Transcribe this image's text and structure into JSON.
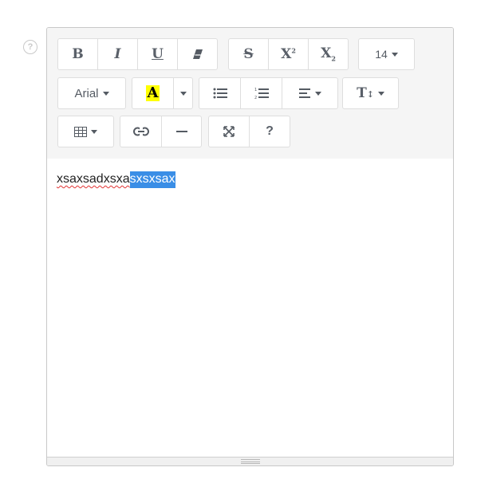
{
  "help": {
    "glyph": "?"
  },
  "toolbar": {
    "bold_glyph": "B",
    "italic_glyph": "I",
    "underline_glyph": "U",
    "strike_glyph": "S",
    "superscript_glyph": "X",
    "superscript_mark": "2",
    "subscript_glyph": "X",
    "subscript_mark": "2",
    "font_size": "14",
    "font_name": "Arial",
    "color_glyph": "A",
    "color_highlight": "#ffff00",
    "help_glyph": "?",
    "line_height_glyph": "T",
    "icons": [
      "eraser-icon",
      "unordered-list-icon",
      "ordered-list-icon",
      "align-left-icon",
      "table-icon",
      "link-icon",
      "horizontal-rule-icon",
      "fullscreen-icon"
    ]
  },
  "content": {
    "plain_text": "xsaxsadxsxa",
    "selected_text": "sxsxsax",
    "selection_color": "#3a8ee6"
  }
}
